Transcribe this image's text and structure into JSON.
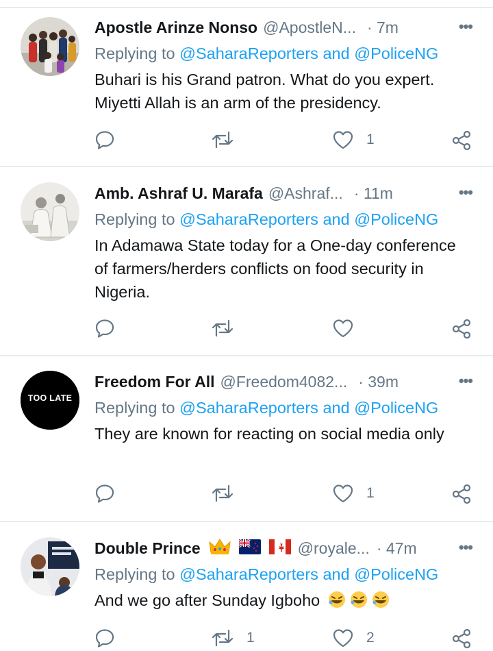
{
  "tweets": [
    {
      "name": "Apostle Arinze Nonso",
      "handle": "@ApostleN...",
      "time": "· 7m",
      "replying_prefix": "Replying to",
      "mention1": "@SaharaReporters",
      "and": "and",
      "mention2": "@PoliceNG",
      "text": "Buhari is his Grand patron. What do you expert. Miyetti Allah is an arm of the presidency.",
      "retweets": "",
      "likes": "1"
    },
    {
      "name": "Amb. Ashraf U. Marafa",
      "handle": "@Ashraf...",
      "time": "· 11m",
      "replying_prefix": "Replying to",
      "mention1": "@SaharaReporters",
      "and": "and",
      "mention2": "@PoliceNG",
      "text": "In Adamawa State today for a One-day conference of farmers/herders conflicts on food security in Nigeria.",
      "retweets": "",
      "likes": ""
    },
    {
      "name": "Freedom For All",
      "handle": "@Freedom4082...",
      "time": "· 39m",
      "avatar_text": "TOO LATE",
      "replying_prefix": "Replying to",
      "mention1": "@SaharaReporters",
      "and": "and",
      "mention2": "@PoliceNG",
      "text": "They are known for reacting on social media only",
      "retweets": "",
      "likes": "1"
    },
    {
      "name": "Double Prince",
      "handle": "@royale...",
      "time": "· 47m",
      "replying_prefix": "Replying to",
      "mention1": "@SaharaReporters",
      "and": "and",
      "mention2": "@PoliceNG",
      "text": "And we go after Sunday Igboho",
      "retweets": "1",
      "likes": "2"
    }
  ],
  "colors": {
    "accent": "#1da1f2",
    "muted": "#657786",
    "text": "#14171a",
    "divider": "#e6ecf0"
  },
  "icons": [
    "reply-icon",
    "retweet-icon",
    "like-icon",
    "share-icon",
    "more-icon"
  ]
}
